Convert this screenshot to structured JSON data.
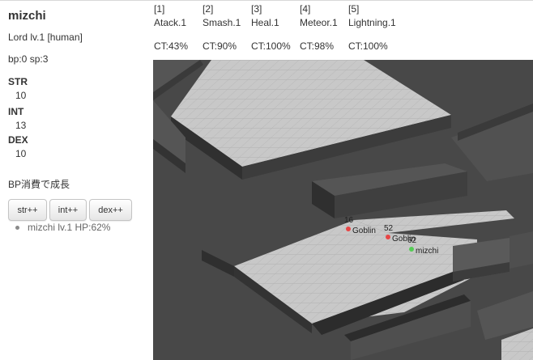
{
  "player": {
    "name": "mizchi",
    "title": "Lord lv.1 [human]",
    "points": "bp:0 sp:3",
    "stats": [
      {
        "label": "STR",
        "value": "10"
      },
      {
        "label": "INT",
        "value": "13"
      },
      {
        "label": "DEX",
        "value": "10"
      }
    ]
  },
  "growth": {
    "heading": "BP消費で成長",
    "buttons": [
      "str++",
      "int++",
      "dex++"
    ]
  },
  "party": [
    "mizchi lv.1 HP:62%"
  ],
  "skills": [
    {
      "key": "[1]",
      "name": "Atack.1",
      "ct": "CT:43%"
    },
    {
      "key": "[2]",
      "name": "Smash.1",
      "ct": "CT:90%"
    },
    {
      "key": "[3]",
      "name": "Heal.1",
      "ct": "CT:100%"
    },
    {
      "key": "[4]",
      "name": "Meteor.1",
      "ct": "CT:98%"
    },
    {
      "key": "[5]",
      "name": "Lightning.1",
      "ct": "CT:100%"
    }
  ],
  "entities": [
    {
      "hp": "16",
      "name": "Goblin",
      "type": "enemy"
    },
    {
      "hp": "52",
      "name": "Goblin",
      "type": "enemy"
    },
    {
      "hp": "62",
      "name": "mizchi",
      "type": "player"
    }
  ],
  "colors": {
    "enemy_marker": "#e84545",
    "player_marker": "#55cc55",
    "floor": "#c8c8c8",
    "wall_top": "#4c4c4c",
    "wall_face": "#2e2e2e"
  }
}
